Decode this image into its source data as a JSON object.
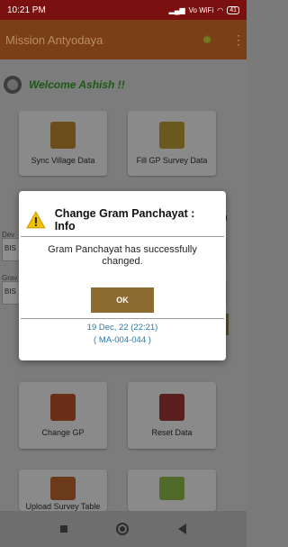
{
  "status_bar": {
    "time": "10:21 PM",
    "network_label": "Vo WiFi",
    "battery": "41"
  },
  "app_bar": {
    "title": "Mission Antyodaya",
    "actions": [
      "sync-icon",
      "more-vert-icon"
    ]
  },
  "welcome": {
    "text": "Welcome Ashish !!"
  },
  "tiles": [
    {
      "label": "Sync Village Data",
      "icon": "database-sync-icon"
    },
    {
      "label": "Fill GP Survey Data",
      "icon": "survey-form-icon"
    },
    {
      "label": "Change GP",
      "icon": "location-swap-icon"
    },
    {
      "label": "Reset Data",
      "icon": "reset-data-icon"
    },
    {
      "label": "Upload Survey Table",
      "icon": "upload-form-icon"
    },
    {
      "label": "",
      "icon": "map-icon"
    }
  ],
  "background_panel": {
    "label1": "Dev",
    "value1": "BIS",
    "label2": "Grav",
    "value2": "BIS"
  },
  "dialog": {
    "title": "Change Gram Panchayat : Info",
    "message": "Gram Panchayat has successfully changed.",
    "ok_label": "OK",
    "date": "19 Dec, 22 (22:21)",
    "code": "( MA-004-044 )"
  },
  "colors": {
    "status_bar": "#7b1010",
    "app_bar": "#7a3f17",
    "ok_button": "#8b6b2f",
    "link_blue": "#2b7aa6",
    "welcome_green": "#1a5a12"
  }
}
